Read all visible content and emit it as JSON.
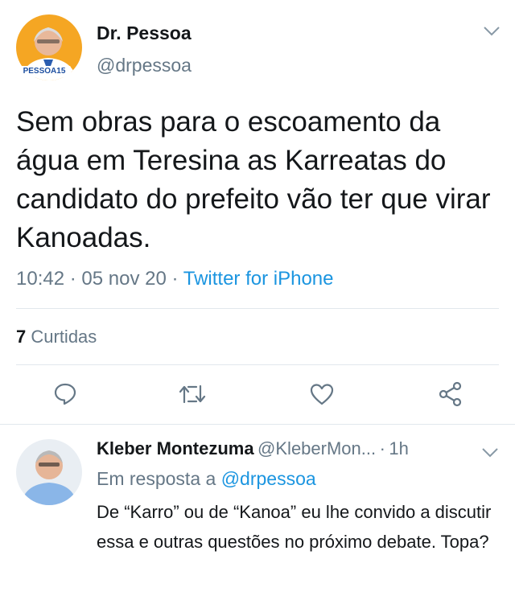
{
  "tweet": {
    "author_name": "Dr. Pessoa",
    "author_handle": "@drpessoa",
    "avatar_badge": "PESSOA15",
    "text": "Sem obras para o escoamento da água em Teresina as Karreatas do candidato do prefeito vão ter que virar Kanoadas.",
    "time": "10:42",
    "date": "05 nov 20",
    "source": "Twitter for iPhone",
    "likes_count": "7",
    "likes_label": "Curtidas"
  },
  "actions": [
    {
      "icon": "reply-icon"
    },
    {
      "icon": "retweet-icon"
    },
    {
      "icon": "like-icon"
    },
    {
      "icon": "share-icon"
    }
  ],
  "reply": {
    "author_name": "Kleber Montezuma",
    "author_handle": "@KleberMon...",
    "time": "1h",
    "in_reply_prefix": "Em resposta a",
    "in_reply_to": "@drpessoa",
    "text": "De “Karro” ou de “Kanoa” eu lhe convido a discutir essa e outras questões no próximo debate. Topa?"
  },
  "colors": {
    "link": "#1b95e0",
    "secondary": "#657786",
    "avatar_bg": "#f7a51e"
  }
}
